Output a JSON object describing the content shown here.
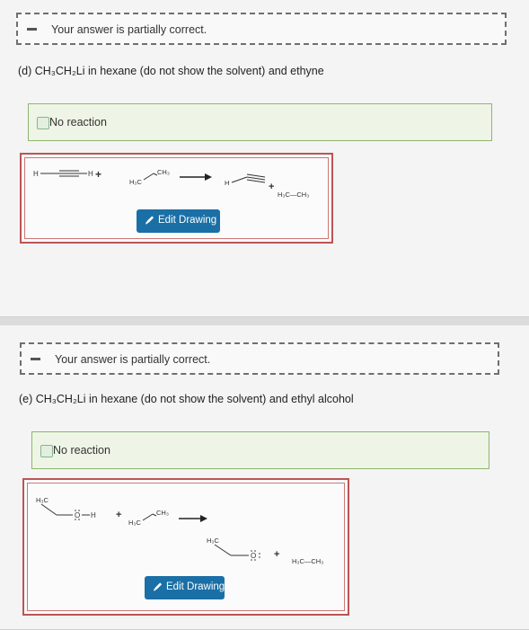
{
  "part_d": {
    "feedback": "Your answer is partially correct.",
    "question": "(d) CH₃CH₂Li in hexane (do not show the solvent) and ethyne",
    "option": "No reaction",
    "edit_button": "Edit Drawing",
    "drawing": {
      "reactant_h_left": "H",
      "reactant_h_right": "H",
      "plus": "+",
      "reagent_top": "CH₃",
      "reagent_bottom": "H₃C",
      "product_h": "H",
      "product_plus": "+",
      "product_ethane": "H₃C—CH₃"
    }
  },
  "part_e": {
    "feedback": "Your answer is partially correct.",
    "question": "(e) CH₃CH₂Li in hexane (do not show the solvent) and ethyl alcohol",
    "option": "No reaction",
    "edit_button": "Edit Drawing",
    "drawing": {
      "reactant_methyl": "H₃C",
      "reactant_oxygen": "O",
      "reactant_h": "H",
      "plus": "+",
      "reagent_top": "CH₃",
      "reagent_bottom": "H₃C",
      "product_methyl": "H₃C",
      "product_oxygen": "O",
      "product_plus": "+",
      "product_ethane": "H₃C—CH₃"
    }
  }
}
